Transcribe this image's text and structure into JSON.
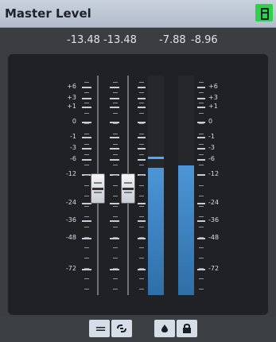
{
  "window": {
    "title": "Master Level",
    "pin_icon": "pin-icon"
  },
  "readouts": {
    "left_peak": "-13.48",
    "right_peak": "-13.48",
    "left_meter": "-7.88",
    "right_meter": "-8.96"
  },
  "scale_left": [
    "+6",
    "+3",
    "+1",
    "0",
    "-1",
    "-3",
    "-6",
    "-12",
    "-24",
    "-36",
    "-48",
    "-72"
  ],
  "scale_right": [
    "+6",
    "+3",
    "+1",
    "0",
    "-1",
    "-3",
    "-6",
    "-12",
    "-24",
    "-36",
    "-48",
    "-72"
  ],
  "meters": {
    "left_level_fraction": 0.58,
    "right_level_fraction": 0.59,
    "left_peak_fraction": 0.63
  },
  "controls": {
    "link_button_label": "=",
    "link_icon": "link-icon",
    "drop_icon": "drop-icon",
    "lock_icon": "lock-icon"
  },
  "colors": {
    "meter_fill": "#3f86c7",
    "peak": "#4ea8ff",
    "pin": "#2fd14a"
  }
}
